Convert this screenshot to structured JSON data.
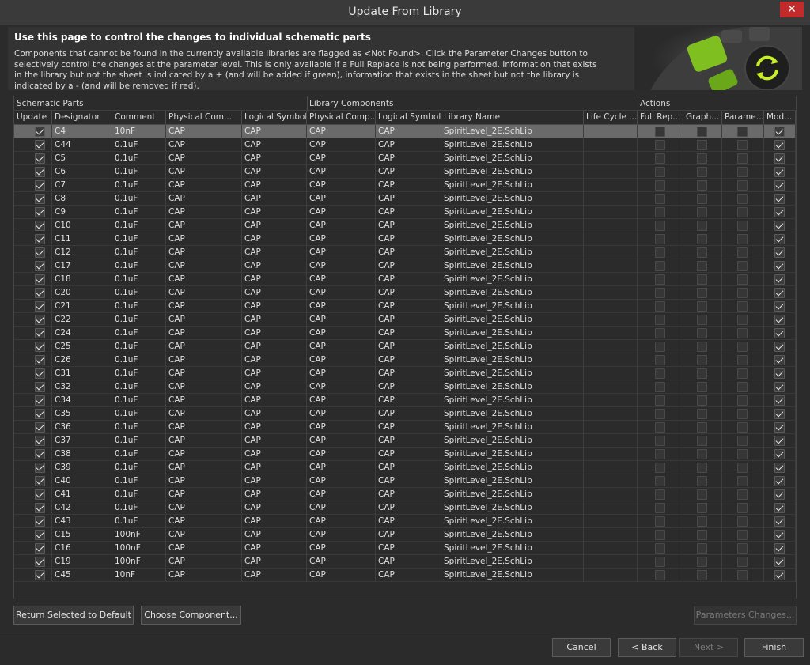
{
  "window": {
    "title": "Update From Library",
    "close_glyph": "✕"
  },
  "header": {
    "heading": "Use this page to control the changes to individual schematic parts",
    "description": "Components that cannot be found in the currently available libraries are flagged as <Not Found>. Click the Parameter Changes button to selectively control the changes at the parameter level. This is only available if a Full Replace is not being performed. Information that exists in the library but not the sheet is indicated by a + (and will be added if green), information that exists in the sheet but not the library is indicated by a - (and will be removed if red)."
  },
  "grid": {
    "groups": {
      "schematic": "Schematic Parts",
      "library": "Library Components",
      "actions": "Actions"
    },
    "columns": [
      "Update",
      "Designator",
      "Comment",
      "Physical Com...",
      "Logical Symbol",
      "Physical Comp...",
      "Logical Symbol",
      "Library Name",
      "Life Cycle ...",
      "Full Rep...",
      "Graph...",
      "Parame...",
      "Mod..."
    ],
    "rows": [
      {
        "designator": "C4",
        "comment": "10nF",
        "phys": "CAP",
        "logical": "CAP",
        "lib_phys": "CAP",
        "lib_logical": "CAP",
        "library": "SpiritLevel_2E.SchLib"
      },
      {
        "designator": "C44",
        "comment": "0.1uF",
        "phys": "CAP",
        "logical": "CAP",
        "lib_phys": "CAP",
        "lib_logical": "CAP",
        "library": "SpiritLevel_2E.SchLib"
      },
      {
        "designator": "C5",
        "comment": "0.1uF",
        "phys": "CAP",
        "logical": "CAP",
        "lib_phys": "CAP",
        "lib_logical": "CAP",
        "library": "SpiritLevel_2E.SchLib"
      },
      {
        "designator": "C6",
        "comment": "0.1uF",
        "phys": "CAP",
        "logical": "CAP",
        "lib_phys": "CAP",
        "lib_logical": "CAP",
        "library": "SpiritLevel_2E.SchLib"
      },
      {
        "designator": "C7",
        "comment": "0.1uF",
        "phys": "CAP",
        "logical": "CAP",
        "lib_phys": "CAP",
        "lib_logical": "CAP",
        "library": "SpiritLevel_2E.SchLib"
      },
      {
        "designator": "C8",
        "comment": "0.1uF",
        "phys": "CAP",
        "logical": "CAP",
        "lib_phys": "CAP",
        "lib_logical": "CAP",
        "library": "SpiritLevel_2E.SchLib"
      },
      {
        "designator": "C9",
        "comment": "0.1uF",
        "phys": "CAP",
        "logical": "CAP",
        "lib_phys": "CAP",
        "lib_logical": "CAP",
        "library": "SpiritLevel_2E.SchLib"
      },
      {
        "designator": "C10",
        "comment": "0.1uF",
        "phys": "CAP",
        "logical": "CAP",
        "lib_phys": "CAP",
        "lib_logical": "CAP",
        "library": "SpiritLevel_2E.SchLib"
      },
      {
        "designator": "C11",
        "comment": "0.1uF",
        "phys": "CAP",
        "logical": "CAP",
        "lib_phys": "CAP",
        "lib_logical": "CAP",
        "library": "SpiritLevel_2E.SchLib"
      },
      {
        "designator": "C12",
        "comment": "0.1uF",
        "phys": "CAP",
        "logical": "CAP",
        "lib_phys": "CAP",
        "lib_logical": "CAP",
        "library": "SpiritLevel_2E.SchLib"
      },
      {
        "designator": "C17",
        "comment": "0.1uF",
        "phys": "CAP",
        "logical": "CAP",
        "lib_phys": "CAP",
        "lib_logical": "CAP",
        "library": "SpiritLevel_2E.SchLib"
      },
      {
        "designator": "C18",
        "comment": "0.1uF",
        "phys": "CAP",
        "logical": "CAP",
        "lib_phys": "CAP",
        "lib_logical": "CAP",
        "library": "SpiritLevel_2E.SchLib"
      },
      {
        "designator": "C20",
        "comment": "0.1uF",
        "phys": "CAP",
        "logical": "CAP",
        "lib_phys": "CAP",
        "lib_logical": "CAP",
        "library": "SpiritLevel_2E.SchLib"
      },
      {
        "designator": "C21",
        "comment": "0.1uF",
        "phys": "CAP",
        "logical": "CAP",
        "lib_phys": "CAP",
        "lib_logical": "CAP",
        "library": "SpiritLevel_2E.SchLib"
      },
      {
        "designator": "C22",
        "comment": "0.1uF",
        "phys": "CAP",
        "logical": "CAP",
        "lib_phys": "CAP",
        "lib_logical": "CAP",
        "library": "SpiritLevel_2E.SchLib"
      },
      {
        "designator": "C24",
        "comment": "0.1uF",
        "phys": "CAP",
        "logical": "CAP",
        "lib_phys": "CAP",
        "lib_logical": "CAP",
        "library": "SpiritLevel_2E.SchLib"
      },
      {
        "designator": "C25",
        "comment": "0.1uF",
        "phys": "CAP",
        "logical": "CAP",
        "lib_phys": "CAP",
        "lib_logical": "CAP",
        "library": "SpiritLevel_2E.SchLib"
      },
      {
        "designator": "C26",
        "comment": "0.1uF",
        "phys": "CAP",
        "logical": "CAP",
        "lib_phys": "CAP",
        "lib_logical": "CAP",
        "library": "SpiritLevel_2E.SchLib"
      },
      {
        "designator": "C31",
        "comment": "0.1uF",
        "phys": "CAP",
        "logical": "CAP",
        "lib_phys": "CAP",
        "lib_logical": "CAP",
        "library": "SpiritLevel_2E.SchLib"
      },
      {
        "designator": "C32",
        "comment": "0.1uF",
        "phys": "CAP",
        "logical": "CAP",
        "lib_phys": "CAP",
        "lib_logical": "CAP",
        "library": "SpiritLevel_2E.SchLib"
      },
      {
        "designator": "C34",
        "comment": "0.1uF",
        "phys": "CAP",
        "logical": "CAP",
        "lib_phys": "CAP",
        "lib_logical": "CAP",
        "library": "SpiritLevel_2E.SchLib"
      },
      {
        "designator": "C35",
        "comment": "0.1uF",
        "phys": "CAP",
        "logical": "CAP",
        "lib_phys": "CAP",
        "lib_logical": "CAP",
        "library": "SpiritLevel_2E.SchLib"
      },
      {
        "designator": "C36",
        "comment": "0.1uF",
        "phys": "CAP",
        "logical": "CAP",
        "lib_phys": "CAP",
        "lib_logical": "CAP",
        "library": "SpiritLevel_2E.SchLib"
      },
      {
        "designator": "C37",
        "comment": "0.1uF",
        "phys": "CAP",
        "logical": "CAP",
        "lib_phys": "CAP",
        "lib_logical": "CAP",
        "library": "SpiritLevel_2E.SchLib"
      },
      {
        "designator": "C38",
        "comment": "0.1uF",
        "phys": "CAP",
        "logical": "CAP",
        "lib_phys": "CAP",
        "lib_logical": "CAP",
        "library": "SpiritLevel_2E.SchLib"
      },
      {
        "designator": "C39",
        "comment": "0.1uF",
        "phys": "CAP",
        "logical": "CAP",
        "lib_phys": "CAP",
        "lib_logical": "CAP",
        "library": "SpiritLevel_2E.SchLib"
      },
      {
        "designator": "C40",
        "comment": "0.1uF",
        "phys": "CAP",
        "logical": "CAP",
        "lib_phys": "CAP",
        "lib_logical": "CAP",
        "library": "SpiritLevel_2E.SchLib"
      },
      {
        "designator": "C41",
        "comment": "0.1uF",
        "phys": "CAP",
        "logical": "CAP",
        "lib_phys": "CAP",
        "lib_logical": "CAP",
        "library": "SpiritLevel_2E.SchLib"
      },
      {
        "designator": "C42",
        "comment": "0.1uF",
        "phys": "CAP",
        "logical": "CAP",
        "lib_phys": "CAP",
        "lib_logical": "CAP",
        "library": "SpiritLevel_2E.SchLib"
      },
      {
        "designator": "C43",
        "comment": "0.1uF",
        "phys": "CAP",
        "logical": "CAP",
        "lib_phys": "CAP",
        "lib_logical": "CAP",
        "library": "SpiritLevel_2E.SchLib"
      },
      {
        "designator": "C15",
        "comment": "100nF",
        "phys": "CAP",
        "logical": "CAP",
        "lib_phys": "CAP",
        "lib_logical": "CAP",
        "library": "SpiritLevel_2E.SchLib"
      },
      {
        "designator": "C16",
        "comment": "100nF",
        "phys": "CAP",
        "logical": "CAP",
        "lib_phys": "CAP",
        "lib_logical": "CAP",
        "library": "SpiritLevel_2E.SchLib"
      },
      {
        "designator": "C19",
        "comment": "100nF",
        "phys": "CAP",
        "logical": "CAP",
        "lib_phys": "CAP",
        "lib_logical": "CAP",
        "library": "SpiritLevel_2E.SchLib"
      },
      {
        "designator": "C45",
        "comment": "10nF",
        "phys": "CAP",
        "logical": "CAP",
        "lib_phys": "CAP",
        "lib_logical": "CAP",
        "library": "SpiritLevel_2E.SchLib"
      }
    ]
  },
  "buttons": {
    "return_default": "Return Selected to Default",
    "choose_component": "Choose Component...",
    "parameters_changes": "Parameters Changes...",
    "cancel": "Cancel",
    "back": "< Back",
    "next": "Next >",
    "finish": "Finish"
  },
  "colors": {
    "accent": "#9be22d",
    "close": "#c22b2b"
  }
}
